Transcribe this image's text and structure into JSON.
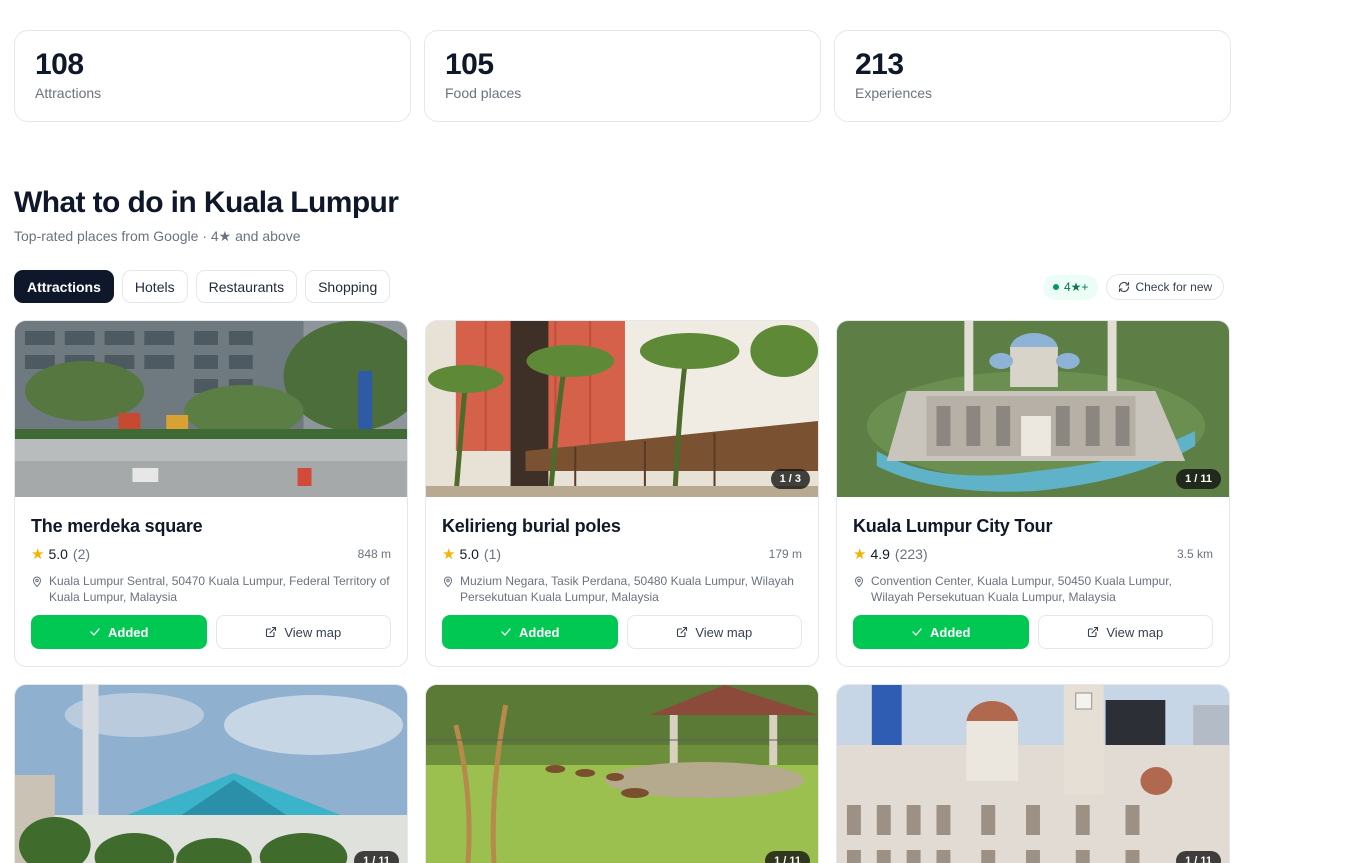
{
  "stats": [
    {
      "value": "108",
      "label": "Attractions"
    },
    {
      "value": "105",
      "label": "Food places"
    },
    {
      "value": "213",
      "label": "Experiences"
    }
  ],
  "heading": "What to do in Kuala Lumpur",
  "subheading": "Top-rated places from Google · 4★ and above",
  "tabs": [
    {
      "label": "Attractions",
      "active": true
    },
    {
      "label": "Hotels",
      "active": false
    },
    {
      "label": "Restaurants",
      "active": false
    },
    {
      "label": "Shopping",
      "active": false
    }
  ],
  "rating_filter": "4★+",
  "check_label": "Check for new",
  "places": [
    {
      "title": "The merdeka square",
      "rating": "5.0",
      "reviews": "(2)",
      "distance": "848 m",
      "address": "Kuala Lumpur Sentral, 50470 Kuala Lumpur, Federal Territory of Kuala Lumpur, Malaysia",
      "photo_counter": "",
      "added_label": "Added",
      "map_label": "View map"
    },
    {
      "title": "Kelirieng burial poles",
      "rating": "5.0",
      "reviews": "(1)",
      "distance": "179 m",
      "address": "Muzium Negara, Tasik Perdana, 50480 Kuala Lumpur, Wilayah Persekutuan Kuala Lumpur, Malaysia",
      "photo_counter": "1 / 3",
      "added_label": "Added",
      "map_label": "View map"
    },
    {
      "title": "Kuala Lumpur City Tour",
      "rating": "4.9",
      "reviews": "(223)",
      "distance": "3.5 km",
      "address": "Convention Center, Kuala Lumpur, 50450 Kuala Lumpur, Wilayah Persekutuan Kuala Lumpur, Malaysia",
      "photo_counter": "1 / 11",
      "added_label": "Added",
      "map_label": "View map"
    }
  ],
  "more_photos": [
    {
      "photo_counter": "1 / 11"
    },
    {
      "photo_counter": "1 / 11"
    },
    {
      "photo_counter": "1 / 11"
    }
  ]
}
